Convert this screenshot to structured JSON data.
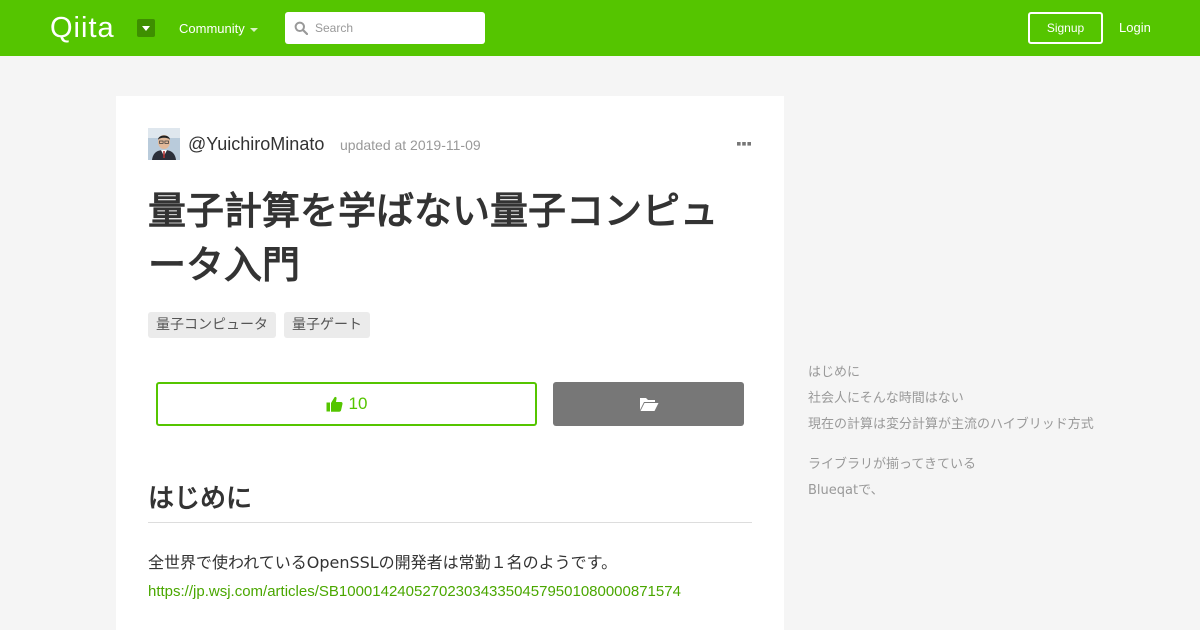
{
  "header": {
    "logo": "Qiita",
    "community_label": "Community",
    "search_placeholder": "Search",
    "signup_label": "Signup",
    "login_label": "Login",
    "brand_color": "#55c500"
  },
  "article": {
    "author": "@YuichiroMinato",
    "updated": "updated at 2019-11-09",
    "title": "量子計算を学ばない量子コンピュータ入門",
    "tags": [
      "量子コンピュータ",
      "量子ゲート"
    ],
    "like_count": "10",
    "section_heading": "はじめに",
    "body_text": "全世界で使われているOpenSSLの開発者は常勤１名のようです。",
    "body_link": "https://jp.wsj.com/articles/SB10001424052702303433504579501080000871574"
  },
  "toc": {
    "items": [
      "はじめに",
      "社会人にそんな時間はない",
      "現在の計算は変分計算が主流のハイブリッド方式",
      "ライブラリが揃ってきている",
      "Blueqatで、"
    ]
  },
  "icons": {
    "search": "search-icon",
    "more": "more-horizontal-icon",
    "like": "thumbs-up-icon",
    "stock": "folder-open-icon"
  }
}
